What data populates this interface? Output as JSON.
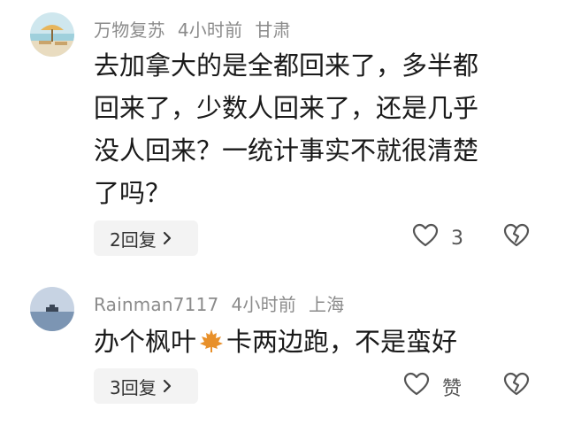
{
  "comments": [
    {
      "username": "万物复苏",
      "time": "4小时前",
      "location": "甘肃",
      "lines": [
        "去加拿大的是全都回来了，多半都",
        "回来了，少数人回来了，还是几乎",
        "没人回来？一统计事实不就很清楚",
        "了吗？"
      ],
      "reply_label": "2回复",
      "like_count": "3"
    },
    {
      "username": "Rainman7117",
      "time": "4小时前",
      "location": "上海",
      "text_before_emoji": "办个枫叶",
      "emoji": "maple-leaf-icon",
      "text_after_emoji": "卡两边跑，不是蛮好",
      "reply_label": "3回复",
      "like_label": "赞"
    }
  ],
  "colors": {
    "meta": "#8b8b8b",
    "text": "#1a1a1a",
    "reply_bg": "#f3f3f3",
    "maple": "#e8902a"
  }
}
